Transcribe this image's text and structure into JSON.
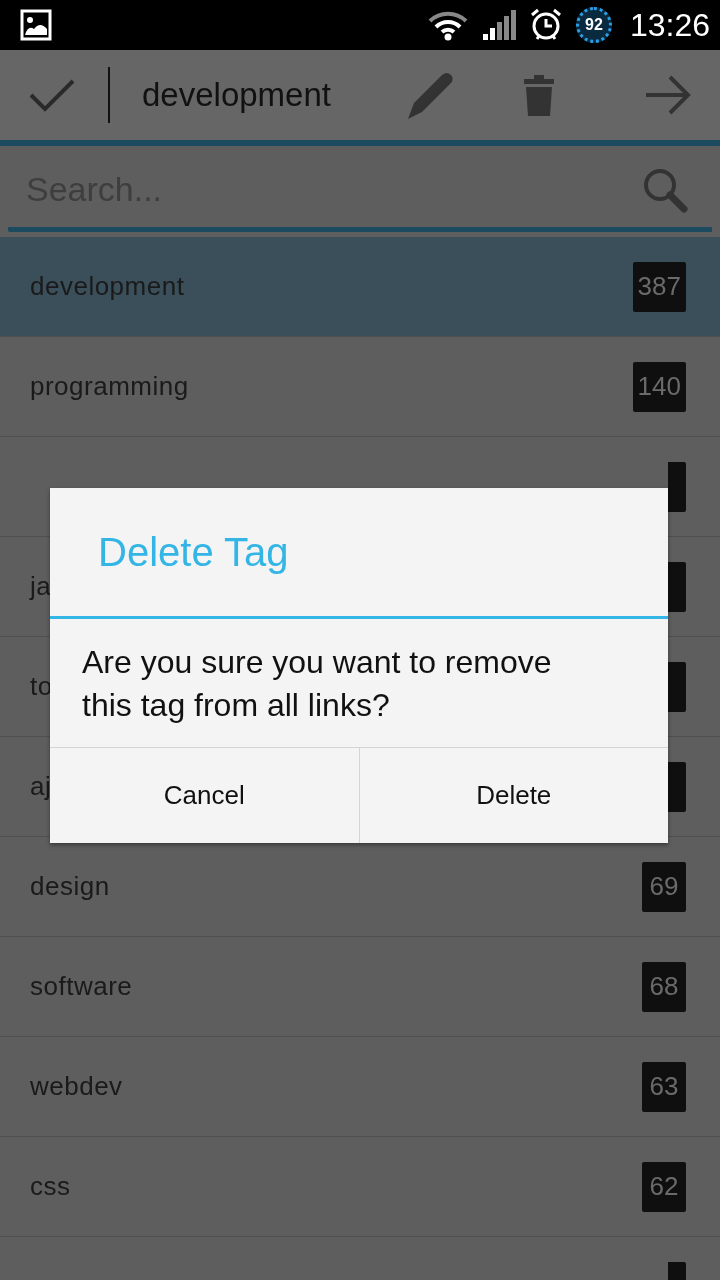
{
  "status_bar": {
    "battery": "92",
    "time": "13:26"
  },
  "action_bar": {
    "title": "development"
  },
  "search": {
    "placeholder": "Search..."
  },
  "tags": [
    {
      "name": "development",
      "count": "387",
      "selected": true
    },
    {
      "name": "programming",
      "count": "140",
      "selected": false
    },
    {
      "selected": false
    },
    {
      "name": "ja",
      "selected": false
    },
    {
      "name": "to",
      "selected": false
    },
    {
      "name": "aj",
      "selected": false
    },
    {
      "name": "design",
      "count": "69",
      "selected": false
    },
    {
      "name": "software",
      "count": "68",
      "selected": false
    },
    {
      "name": "webdev",
      "count": "63",
      "selected": false
    },
    {
      "name": "css",
      "count": "62",
      "selected": false
    },
    {
      "selected": false
    }
  ],
  "dialog": {
    "title": "Delete Tag",
    "message": "Are you sure you want to remove this tag from all links?",
    "buttons": [
      "Cancel",
      "Delete"
    ]
  }
}
